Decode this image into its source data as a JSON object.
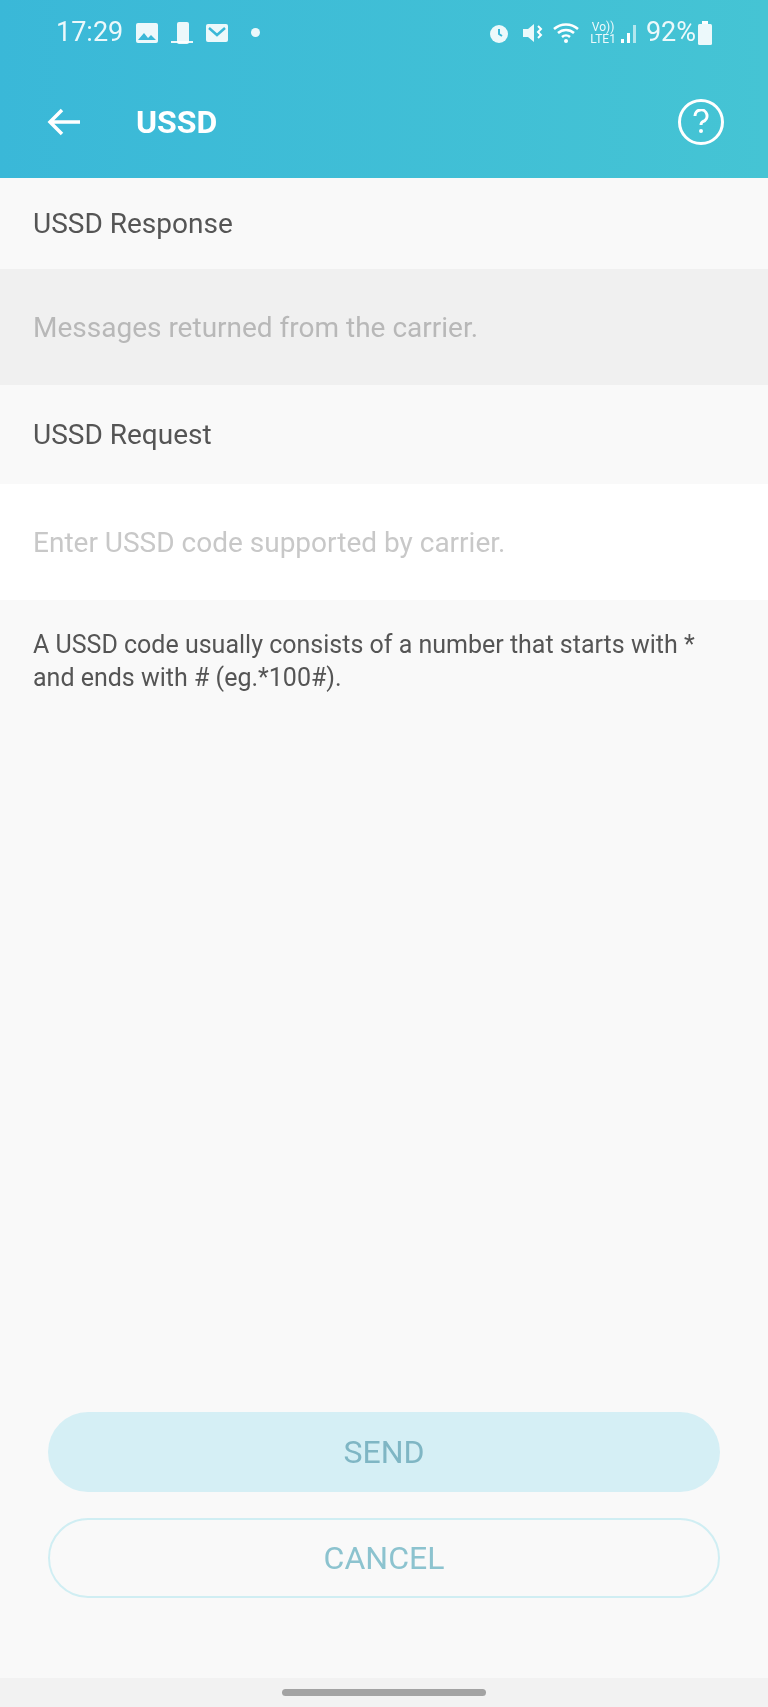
{
  "status_bar": {
    "time": "17:29",
    "volte": "Vo))",
    "network": "LTE1",
    "battery": "92%"
  },
  "header": {
    "title": "USSD"
  },
  "response": {
    "label": "USSD Response",
    "placeholder": "Messages returned from the carrier."
  },
  "request": {
    "label": "USSD Request",
    "placeholder": "Enter USSD code supported by carrier."
  },
  "help_text": "A USSD code usually consists of a number that starts with * and ends with # (eg.*100#).",
  "buttons": [
    {
      "kind": "filled",
      "label": "SEND",
      "disabled": true
    },
    {
      "kind": "outline",
      "label": "CANCEL",
      "disabled": true
    }
  ]
}
